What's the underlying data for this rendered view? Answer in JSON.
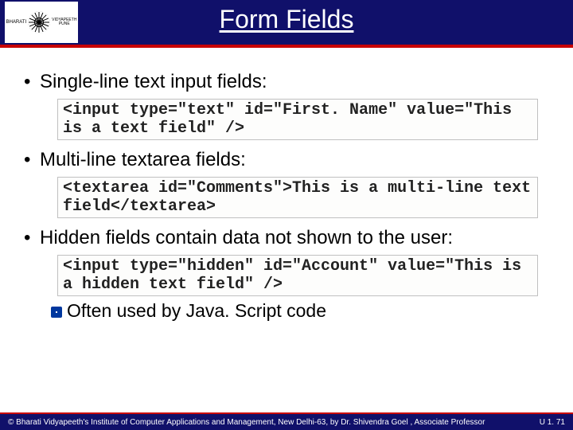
{
  "logo": {
    "left": "BHARATI",
    "right": "VIDYAPEETH",
    "bottom": "PUNE"
  },
  "title": "Form Fields",
  "bullets": [
    {
      "text": "Single-line text input fields:",
      "code": "<input type=\"text\" id=\"First. Name\" value=\"This is a text field\" />"
    },
    {
      "text": "Multi-line textarea fields:",
      "code": "<textarea id=\"Comments\">This is a multi-line text field</textarea>"
    },
    {
      "text": "Hidden fields contain data not shown to the user:",
      "code": "<input type=\"hidden\" id=\"Account\" value=\"This is a hidden text field\" />",
      "sub": "Often used by Java. Script code"
    }
  ],
  "footer": {
    "copyright": "© Bharati Vidyapeeth's Institute of Computer Applications and Management, New Delhi-63, by Dr. Shivendra Goel , Associate Professor",
    "pager": "U 1. 71"
  }
}
